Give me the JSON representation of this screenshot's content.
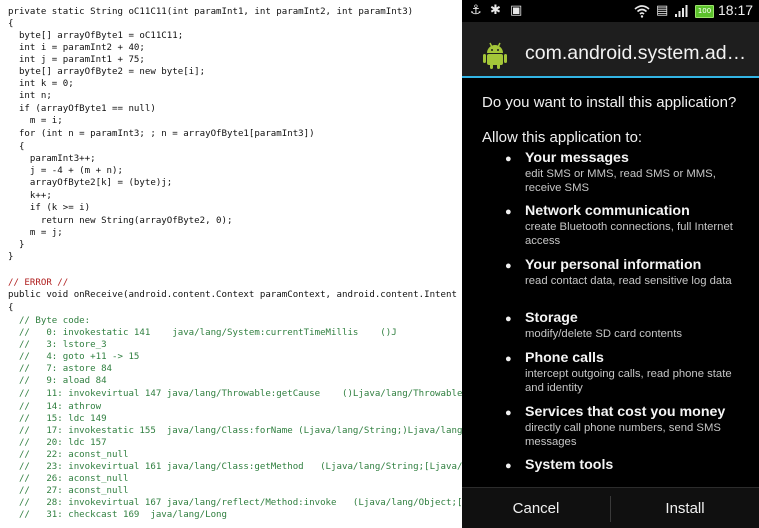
{
  "code_panel": {
    "lines": [
      {
        "text": "private static String oC11C11(int paramInt1, int paramInt2, int paramInt3)",
        "kind": "code"
      },
      {
        "text": "{",
        "kind": "code"
      },
      {
        "text": "  byte[] arrayOfByte1 = oC11C11;",
        "kind": "code"
      },
      {
        "text": "  int i = paramInt2 + 40;",
        "kind": "code"
      },
      {
        "text": "  int j = paramInt1 + 75;",
        "kind": "code"
      },
      {
        "text": "  byte[] arrayOfByte2 = new byte[i];",
        "kind": "code"
      },
      {
        "text": "  int k = 0;",
        "kind": "code"
      },
      {
        "text": "  int n;",
        "kind": "code"
      },
      {
        "text": "  if (arrayOfByte1 == null)",
        "kind": "code"
      },
      {
        "text": "    m = i;",
        "kind": "code"
      },
      {
        "text": "  for (int n = paramInt3; ; n = arrayOfByte1[paramInt3])",
        "kind": "code"
      },
      {
        "text": "  {",
        "kind": "code"
      },
      {
        "text": "    paramInt3++;",
        "kind": "code"
      },
      {
        "text": "    j = -4 + (m + n);",
        "kind": "code"
      },
      {
        "text": "    arrayOfByte2[k] = (byte)j;",
        "kind": "code"
      },
      {
        "text": "    k++;",
        "kind": "code"
      },
      {
        "text": "    if (k >= i)",
        "kind": "code"
      },
      {
        "text": "      return new String(arrayOfByte2, 0);",
        "kind": "code"
      },
      {
        "text": "    m = j;",
        "kind": "code"
      },
      {
        "text": "  }",
        "kind": "code"
      },
      {
        "text": "}",
        "kind": "code"
      },
      {
        "text": "",
        "kind": "code"
      },
      {
        "text": "// ERROR //",
        "kind": "error"
      },
      {
        "text": "public void onReceive(android.content.Context paramContext, android.content.Intent pa",
        "kind": "code"
      },
      {
        "text": "{",
        "kind": "code"
      },
      {
        "text": "  // Byte code:",
        "kind": "comment"
      },
      {
        "text": "  //   0: invokestatic 141    java/lang/System:currentTimeMillis    ()J",
        "kind": "comment"
      },
      {
        "text": "  //   3: lstore_3",
        "kind": "comment"
      },
      {
        "text": "  //   4: goto +11 -> 15",
        "kind": "comment"
      },
      {
        "text": "  //   7: astore 84",
        "kind": "comment"
      },
      {
        "text": "  //   9: aload 84",
        "kind": "comment"
      },
      {
        "text": "  //   11: invokevirtual 147 java/lang/Throwable:getCause    ()Ljava/lang/Throwable;",
        "kind": "comment"
      },
      {
        "text": "  //   14: athrow",
        "kind": "comment"
      },
      {
        "text": "  //   15: ldc 149",
        "kind": "comment"
      },
      {
        "text": "  //   17: invokestatic 155  java/lang/Class:forName (Ljava/lang/String;)Ljava/lang/C",
        "kind": "comment"
      },
      {
        "text": "  //   20: ldc 157",
        "kind": "comment"
      },
      {
        "text": "  //   22: aconst_null",
        "kind": "comment"
      },
      {
        "text": "  //   23: invokevirtual 161 java/lang/Class:getMethod   (Ljava/lang/String;[Ljava/la",
        "kind": "comment"
      },
      {
        "text": "  //   26: aconst_null",
        "kind": "comment"
      },
      {
        "text": "  //   27: aconst_null",
        "kind": "comment"
      },
      {
        "text": "  //   28: invokevirtual 167 java/lang/reflect/Method:invoke   (Ljava/lang/Object;[L",
        "kind": "comment"
      },
      {
        "text": "  //   31: checkcast 169  java/lang/Long",
        "kind": "comment"
      }
    ]
  },
  "status_bar": {
    "time": "18:17",
    "battery_level": "100",
    "icons": [
      "usb-icon",
      "debug-icon",
      "media-icon",
      "wifi-icon",
      "signal-icon",
      "battery-icon"
    ]
  },
  "dialog": {
    "app_name": "com.android.system.ad…",
    "question": "Do you want to install this application?",
    "allow_heading": "Allow this application to:",
    "permissions": [
      {
        "title": "Your messages",
        "description": "edit SMS or MMS, read SMS or MMS, receive SMS"
      },
      {
        "title": "Network communication",
        "description": "create Bluetooth connections, full Internet access"
      },
      {
        "title": "Your personal information",
        "description": "read contact data, read sensitive log data"
      },
      {
        "title": "Storage",
        "description": "modify/delete SD card contents"
      },
      {
        "title": "Phone calls",
        "description": "intercept outgoing calls, read phone state and identity"
      },
      {
        "title": "Services that cost you money",
        "description": "directly call phone numbers, send SMS messages"
      },
      {
        "title": "System tools",
        "description": ""
      }
    ],
    "cancel_label": "Cancel",
    "install_label": "Install"
  },
  "colors": {
    "accent": "#33b5e5",
    "battery_green": "#5cc22c",
    "code_comment": "#2f7f3f",
    "code_error": "#b02020"
  }
}
